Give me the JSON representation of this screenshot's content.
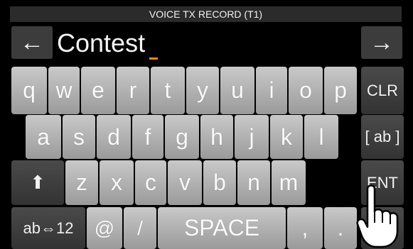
{
  "title": "VOICE TX RECORD (T1)",
  "input": {
    "value": "Contest",
    "left_arrow": "←",
    "right_arrow": "→"
  },
  "keyboard": {
    "row1": [
      "q",
      "w",
      "e",
      "r",
      "t",
      "y",
      "u",
      "i",
      "o",
      "p"
    ],
    "row2": [
      "a",
      "s",
      "d",
      "f",
      "g",
      "h",
      "j",
      "k",
      "l"
    ],
    "row3": [
      "z",
      "x",
      "c",
      "v",
      "b",
      "n",
      "m"
    ],
    "shift_icon": "⬆",
    "mode_label": "ab⇔12",
    "at_label": "@",
    "slash_label": "/",
    "space_label": "SPACE",
    "comma_label": ",",
    "period_label": ".",
    "clr_label": "CLR",
    "ab_label": "[ ab ]",
    "ent_label": "ENT"
  },
  "icons": {
    "pointer": "pointing-hand-icon"
  }
}
